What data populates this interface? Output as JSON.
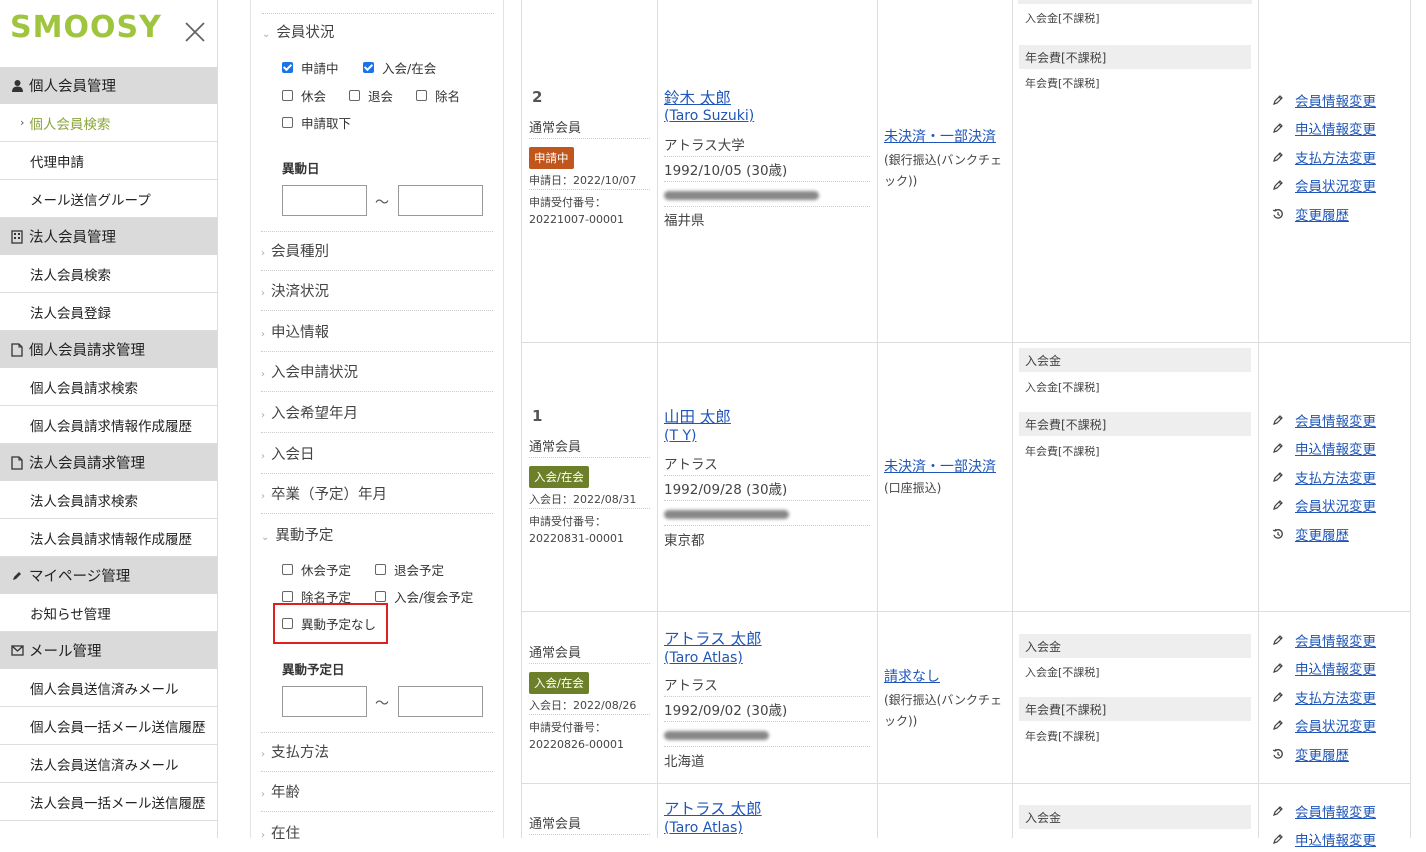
{
  "logo": {
    "text": "SMOOSY",
    "color": "#9ec53d"
  },
  "sidebar": {
    "sections": [
      {
        "icon": "person-icon",
        "label": "個人会員管理",
        "items": [
          "個人会員検索",
          "代理申請",
          "メール送信グループ"
        ]
      },
      {
        "icon": "building-icon",
        "label": "法人会員管理",
        "items": [
          "法人会員検索",
          "法人会員登録"
        ]
      },
      {
        "icon": "document-icon",
        "label": "個人会員請求管理",
        "items": [
          "個人会員請求検索",
          "個人会員請求情報作成履歴"
        ]
      },
      {
        "icon": "document-icon",
        "label": "法人会員請求管理",
        "items": [
          "法人会員請求検索",
          "法人会員請求情報作成履歴"
        ]
      },
      {
        "icon": "pencil-icon",
        "label": "マイページ管理",
        "items": [
          "お知らせ管理"
        ]
      },
      {
        "icon": "mail-icon",
        "label": "メール管理",
        "items": [
          "個人会員送信済みメール",
          "個人会員一括メール送信履歴",
          "法人会員送信済みメール",
          "法人会員一括メール送信履歴"
        ]
      }
    ],
    "active_item": "個人会員検索"
  },
  "filter": {
    "status_title": "会員状況",
    "status_options": [
      {
        "label": "申請中",
        "checked": true
      },
      {
        "label": "入会/在会",
        "checked": true
      },
      {
        "label": "休会",
        "checked": false
      },
      {
        "label": "退会",
        "checked": false
      },
      {
        "label": "除名",
        "checked": false
      },
      {
        "label": "申請取下",
        "checked": false
      }
    ],
    "change_date_label": "異動日",
    "tilde": "～",
    "collapsed": [
      "会員種別",
      "決済状況",
      "申込情報",
      "入会申請状況",
      "入会希望年月",
      "入会日",
      "卒業（予定）年月"
    ],
    "planned_title": "異動予定",
    "planned_options": [
      {
        "label": "休会予定",
        "checked": false
      },
      {
        "label": "退会予定",
        "checked": false
      },
      {
        "label": "除名予定",
        "checked": false
      },
      {
        "label": "入会/復会予定",
        "checked": false
      },
      {
        "label": "異動予定なし",
        "checked": false
      }
    ],
    "planned_date_label": "異動予定日",
    "bottom": [
      "支払方法",
      "年齢",
      "在住"
    ]
  },
  "table": {
    "rows": [
      {
        "num": "2",
        "type": "通常会員",
        "badge": "申請中",
        "badge_color": "#c0561c",
        "date": "申請日：2022/10/07",
        "rec_label": "申請受付番号：",
        "rec_no": "20221007-00001",
        "name": "鈴木 太郎",
        "reading": "(Taro Suzuki)",
        "org": "アトラス大学",
        "birth": "1992/10/05 (30歳)",
        "pref": "福井県",
        "pay_status": "未決済・一部決済",
        "pay_method": "(銀行振込(バンクチェック))",
        "fees": [
          "入会金[不課税]",
          "年会費[不課税]",
          "年会費[不課税]"
        ]
      },
      {
        "num": "1",
        "type": "通常会員",
        "badge": "入会/在会",
        "badge_color": "#6e7f2a",
        "date": "入会日：2022/08/31",
        "rec_label": "申請受付番号：",
        "rec_no": "20220831-00001",
        "name": "山田 太郎",
        "reading": "(T Y)",
        "org": "アトラス",
        "birth": "1992/09/28 (30歳)",
        "pref": "東京都",
        "pay_status": "未決済・一部決済",
        "pay_method": "(口座振込)",
        "fees": [
          "入会金",
          "入会金[不課税]",
          "年会費[不課税]",
          "年会費[不課税]"
        ]
      },
      {
        "type": "通常会員",
        "badge": "入会/在会",
        "badge_color": "#6e7f2a",
        "date": "入会日：2022/08/26",
        "rec_label": "申請受付番号：",
        "rec_no": "20220826-00001",
        "name": "アトラス 太郎",
        "reading": "(Taro Atlas)",
        "org": "アトラス",
        "birth": "1992/09/02 (30歳)",
        "pref": "北海道",
        "pay_status": "請求なし",
        "pay_method": "(銀行振込(バンクチェック))",
        "fees": [
          "入会金",
          "入会金[不課税]",
          "年会費[不課税]",
          "年会費[不課税]"
        ]
      },
      {
        "type": "通常会員",
        "name": "アトラス 太郎",
        "reading": "(Taro Atlas)",
        "fees": [
          "入会金"
        ]
      }
    ],
    "actions": [
      "会員情報変更",
      "申込情報変更",
      "支払方法変更",
      "会員状況変更",
      "変更履歴"
    ]
  }
}
